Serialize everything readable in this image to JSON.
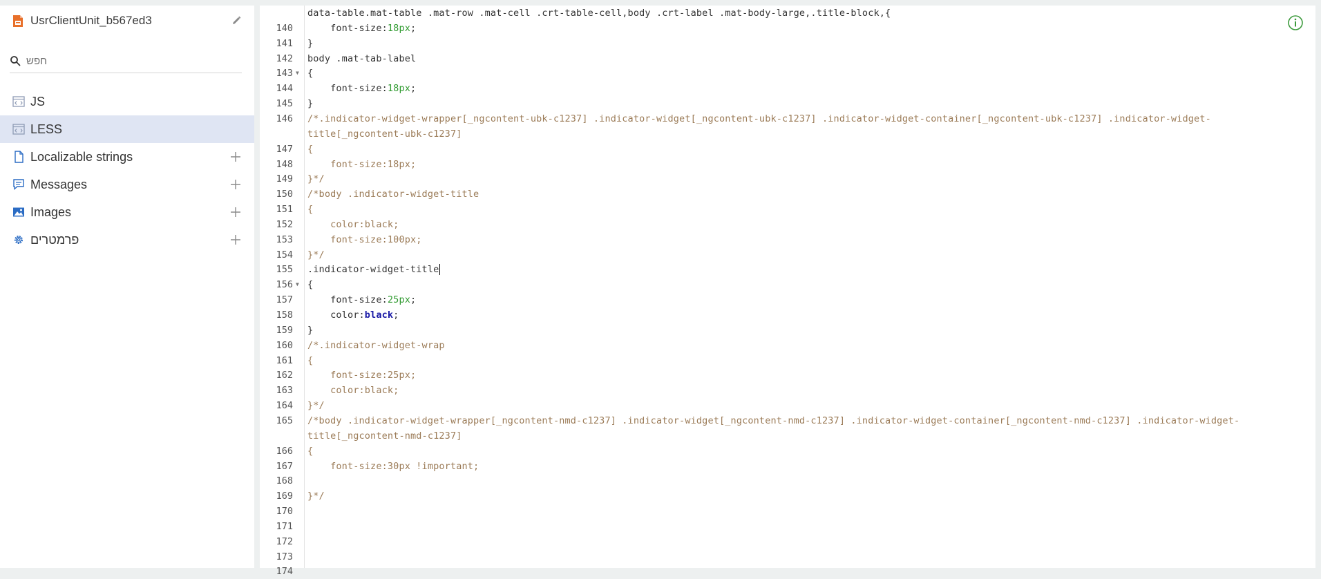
{
  "sidebar": {
    "title": "UsrClientUnit_b567ed3",
    "search_placeholder": "חפש",
    "items": [
      {
        "label": "JS",
        "icon": "code-file-icon",
        "selected": false,
        "addable": false
      },
      {
        "label": "LESS",
        "icon": "code-file-icon",
        "selected": true,
        "addable": false
      },
      {
        "label": "Localizable strings",
        "icon": "document-icon",
        "selected": false,
        "addable": true
      },
      {
        "label": "Messages",
        "icon": "message-icon",
        "selected": false,
        "addable": true
      },
      {
        "label": "Images",
        "icon": "image-icon",
        "selected": false,
        "addable": true
      },
      {
        "label": "פרמטרים",
        "icon": "gear-icon",
        "selected": false,
        "addable": true
      }
    ]
  },
  "editor": {
    "lines": [
      {
        "n": "",
        "fold": false,
        "parts": [
          {
            "t": "data-table.mat-table .mat-row .mat-cell .crt-table-cell,body .crt-label .mat-body-large,.title-block,{",
            "c": ""
          }
        ]
      },
      {
        "n": "140",
        "fold": false,
        "parts": [
          {
            "t": "    font-size:",
            "c": ""
          },
          {
            "t": "18px",
            "c": "num"
          },
          {
            "t": ";",
            "c": ""
          }
        ]
      },
      {
        "n": "141",
        "fold": false,
        "parts": [
          {
            "t": "}",
            "c": ""
          }
        ]
      },
      {
        "n": "142",
        "fold": false,
        "parts": [
          {
            "t": "body .mat-tab-label",
            "c": ""
          }
        ]
      },
      {
        "n": "143",
        "fold": true,
        "parts": [
          {
            "t": "{",
            "c": ""
          }
        ]
      },
      {
        "n": "144",
        "fold": false,
        "parts": [
          {
            "t": "    font-size:",
            "c": ""
          },
          {
            "t": "18px",
            "c": "num"
          },
          {
            "t": ";",
            "c": ""
          }
        ]
      },
      {
        "n": "145",
        "fold": false,
        "parts": [
          {
            "t": "}",
            "c": ""
          }
        ]
      },
      {
        "n": "146",
        "fold": false,
        "parts": [
          {
            "t": "/*.indicator-widget-wrapper[_ngcontent-ubk-c1237] .indicator-widget[_ngcontent-ubk-c1237] .indicator-widget-container[_ngcontent-ubk-c1237] .indicator-widget-",
            "c": "comment"
          }
        ]
      },
      {
        "n": "",
        "fold": false,
        "parts": [
          {
            "t": "title[_ngcontent-ubk-c1237]",
            "c": "comment"
          }
        ]
      },
      {
        "n": "147",
        "fold": false,
        "parts": [
          {
            "t": "{",
            "c": "comment"
          }
        ]
      },
      {
        "n": "148",
        "fold": false,
        "parts": [
          {
            "t": "    font-size:18px;",
            "c": "comment"
          }
        ]
      },
      {
        "n": "149",
        "fold": false,
        "parts": [
          {
            "t": "}*/",
            "c": "comment"
          }
        ]
      },
      {
        "n": "150",
        "fold": false,
        "parts": [
          {
            "t": "/*body .indicator-widget-title",
            "c": "comment"
          }
        ]
      },
      {
        "n": "151",
        "fold": false,
        "parts": [
          {
            "t": "{",
            "c": "comment"
          }
        ]
      },
      {
        "n": "152",
        "fold": false,
        "parts": [
          {
            "t": "    color:black;",
            "c": "comment"
          }
        ]
      },
      {
        "n": "153",
        "fold": false,
        "parts": [
          {
            "t": "    font-size:100px;",
            "c": "comment"
          }
        ]
      },
      {
        "n": "154",
        "fold": false,
        "parts": [
          {
            "t": "}*/",
            "c": "comment"
          }
        ]
      },
      {
        "n": "155",
        "fold": false,
        "cursor": true,
        "parts": [
          {
            "t": ".indicator-widget-title",
            "c": ""
          }
        ]
      },
      {
        "n": "156",
        "fold": true,
        "parts": [
          {
            "t": "{",
            "c": ""
          }
        ]
      },
      {
        "n": "157",
        "fold": false,
        "parts": [
          {
            "t": "    font-size:",
            "c": ""
          },
          {
            "t": "25px",
            "c": "num"
          },
          {
            "t": ";",
            "c": ""
          }
        ]
      },
      {
        "n": "158",
        "fold": false,
        "parts": [
          {
            "t": "    color:",
            "c": ""
          },
          {
            "t": "black",
            "c": "kw"
          },
          {
            "t": ";",
            "c": ""
          }
        ]
      },
      {
        "n": "159",
        "fold": false,
        "parts": [
          {
            "t": "}",
            "c": ""
          }
        ]
      },
      {
        "n": "160",
        "fold": false,
        "parts": [
          {
            "t": "/*.indicator-widget-wrap",
            "c": "comment"
          }
        ]
      },
      {
        "n": "161",
        "fold": false,
        "parts": [
          {
            "t": "{",
            "c": "comment"
          }
        ]
      },
      {
        "n": "162",
        "fold": false,
        "parts": [
          {
            "t": "    font-size:25px;",
            "c": "comment"
          }
        ]
      },
      {
        "n": "163",
        "fold": false,
        "parts": [
          {
            "t": "    color:black;",
            "c": "comment"
          }
        ]
      },
      {
        "n": "164",
        "fold": false,
        "parts": [
          {
            "t": "}*/",
            "c": "comment"
          }
        ]
      },
      {
        "n": "165",
        "fold": false,
        "parts": [
          {
            "t": "/*body .indicator-widget-wrapper[_ngcontent-nmd-c1237] .indicator-widget[_ngcontent-nmd-c1237] .indicator-widget-container[_ngcontent-nmd-c1237] .indicator-widget-",
            "c": "comment"
          }
        ]
      },
      {
        "n": "",
        "fold": false,
        "parts": [
          {
            "t": "title[_ngcontent-nmd-c1237]",
            "c": "comment"
          }
        ]
      },
      {
        "n": "166",
        "fold": false,
        "parts": [
          {
            "t": "{",
            "c": "comment"
          }
        ]
      },
      {
        "n": "167",
        "fold": false,
        "parts": [
          {
            "t": "    font-size:30px !important;",
            "c": "comment"
          }
        ]
      },
      {
        "n": "168",
        "fold": false,
        "parts": []
      },
      {
        "n": "169",
        "fold": false,
        "parts": [
          {
            "t": "}*/",
            "c": "comment"
          }
        ]
      },
      {
        "n": "170",
        "fold": false,
        "parts": []
      },
      {
        "n": "171",
        "fold": false,
        "parts": []
      },
      {
        "n": "172",
        "fold": false,
        "parts": []
      },
      {
        "n": "173",
        "fold": false,
        "parts": []
      },
      {
        "n": "174",
        "fold": false,
        "parts": []
      }
    ]
  },
  "colors": {
    "comment": "#9b7b57",
    "number": "#2f9a2f",
    "keyword": "#1a1aa6",
    "selected_item_bg": "#dfe5f3",
    "info_icon": "#3c9a3c",
    "package_icon": "#e8702a",
    "nav_icon_blue": "#2b6cc4"
  }
}
